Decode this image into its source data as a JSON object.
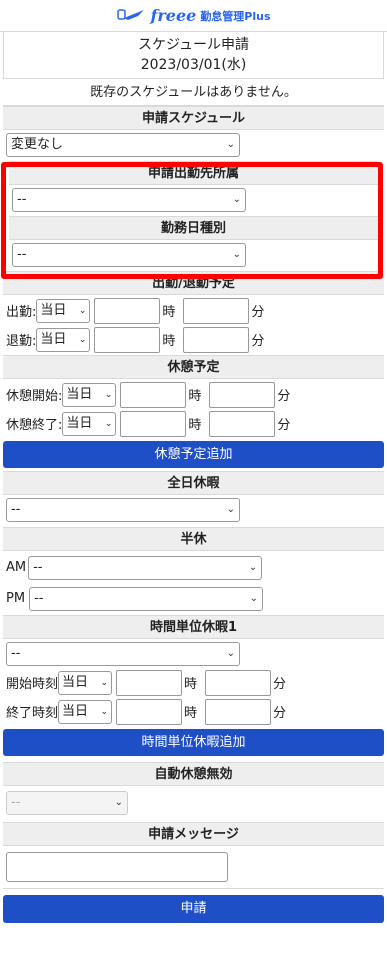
{
  "header": {
    "logo_word": "freee",
    "logo_sub": "勤怠管理Plus"
  },
  "title": {
    "line1": "スケジュール申請",
    "line2": "2023/03/01(水)"
  },
  "notice": "既存のスケジュールはありません。",
  "sections": {
    "schedule": {
      "title": "申請スケジュール",
      "value": "変更なし"
    },
    "office": {
      "title": "申請出勤先所属",
      "value": "--"
    },
    "worktype": {
      "title": "勤務日種別",
      "value": "--"
    },
    "attend": {
      "title": "出勤/退勤予定",
      "rows": [
        {
          "label": "出勤:",
          "day": "当日",
          "h_unit": "時",
          "m_unit": "分"
        },
        {
          "label": "退勤:",
          "day": "当日",
          "h_unit": "時",
          "m_unit": "分"
        }
      ]
    },
    "break": {
      "title": "休憩予定",
      "rows": [
        {
          "label": "休憩開始:",
          "day": "当日",
          "h_unit": "時",
          "m_unit": "分"
        },
        {
          "label": "休憩終了:",
          "day": "当日",
          "h_unit": "時",
          "m_unit": "分"
        }
      ],
      "add_button": "休憩予定追加"
    },
    "fullday": {
      "title": "全日休暇",
      "value": "--"
    },
    "half": {
      "title": "半休",
      "am_label": "AM",
      "am_value": "--",
      "pm_label": "PM",
      "pm_value": "--"
    },
    "hourly": {
      "title": "時間単位休暇1",
      "value": "--",
      "rows": [
        {
          "label": "開始時刻",
          "day": "当日",
          "h_unit": "時",
          "m_unit": "分"
        },
        {
          "label": "終了時刻",
          "day": "当日",
          "h_unit": "時",
          "m_unit": "分"
        }
      ],
      "add_button": "時間単位休暇追加"
    },
    "autobreak": {
      "title": "自動休憩無効",
      "value": "--"
    },
    "message": {
      "title": "申請メッセージ"
    }
  },
  "submit": "申請",
  "colors": {
    "accent": "#1f4fc7",
    "highlight": "#ff0000",
    "logo": "#2864f0"
  }
}
